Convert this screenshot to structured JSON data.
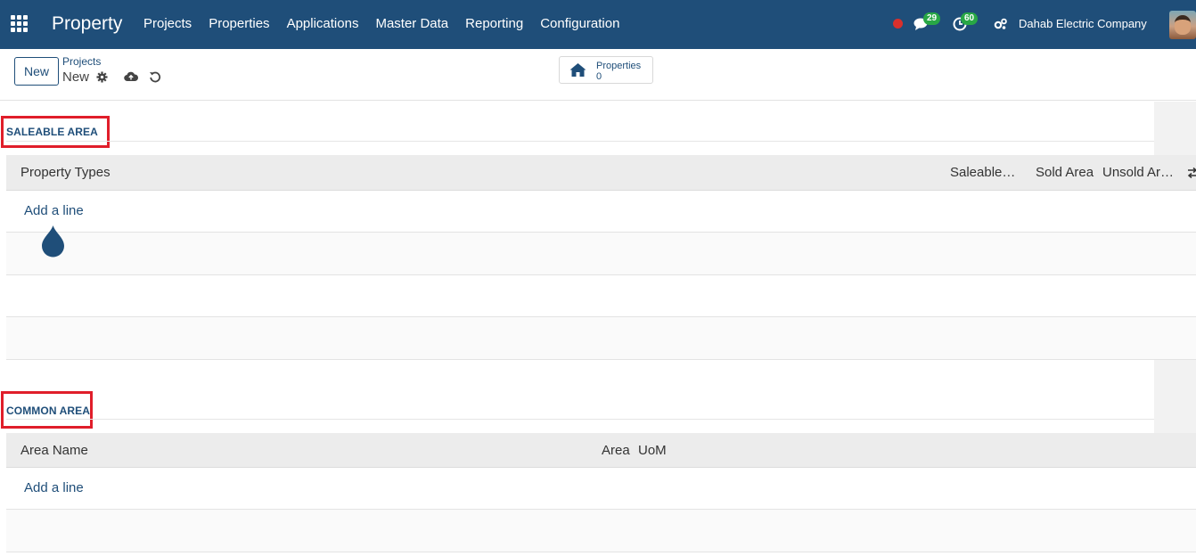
{
  "navbar": {
    "brand": "Property",
    "menu": [
      "Projects",
      "Properties",
      "Applications",
      "Master Data",
      "Reporting",
      "Configuration"
    ],
    "messages_count": "29",
    "activities_count": "60",
    "company": "Dahab Electric Company",
    "colors": {
      "bar": "#1f4e79",
      "badge": "#28a745",
      "record_dot": "#d9302c"
    }
  },
  "control": {
    "new_label": "New",
    "breadcrumb_parent": "Projects",
    "breadcrumb_current": "New",
    "stat_label": "Properties",
    "stat_value": "0"
  },
  "saleable": {
    "title": "SALEABLE AREA",
    "columns": [
      "Property Types",
      "Saleable…",
      "Sold Area",
      "Unsold Ar…"
    ],
    "add_line": "Add a line"
  },
  "common": {
    "title": "COMMON AREA",
    "columns": [
      "Area Name",
      "Area",
      "UoM"
    ],
    "add_line": "Add a line"
  },
  "annotation_color": "#e01e2a"
}
